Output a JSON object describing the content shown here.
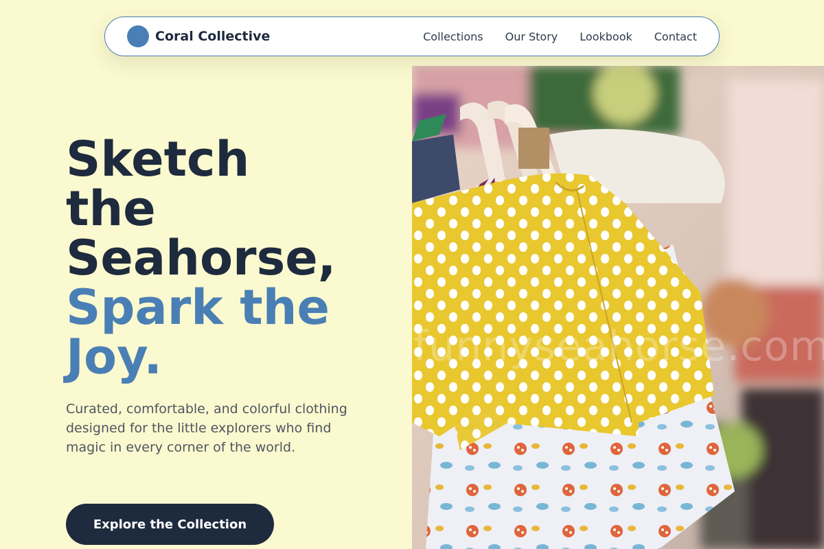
{
  "brand": {
    "name": "Coral Collective",
    "logo_color": "#4a7fb5"
  },
  "nav": {
    "links": [
      "Collections",
      "Our Story",
      "Lookbook",
      "Contact"
    ]
  },
  "hero": {
    "title_line1": "Sketch",
    "title_line2": "the",
    "title_line3": "Seahorse,",
    "title_accent1": "Spark the",
    "title_accent2": "Joy.",
    "description": "Curated, comfortable, and colorful clothing designed for the little explorers who find magic in every corner of the world.",
    "cta_label": "Explore the Collection",
    "image_icon": "kids-clothing-photo",
    "watermark": "funnyseahorse.com"
  },
  "colors": {
    "background": "#fbf9cf",
    "primary_dark": "#1e2a3d",
    "accent": "#4a7fb5"
  }
}
